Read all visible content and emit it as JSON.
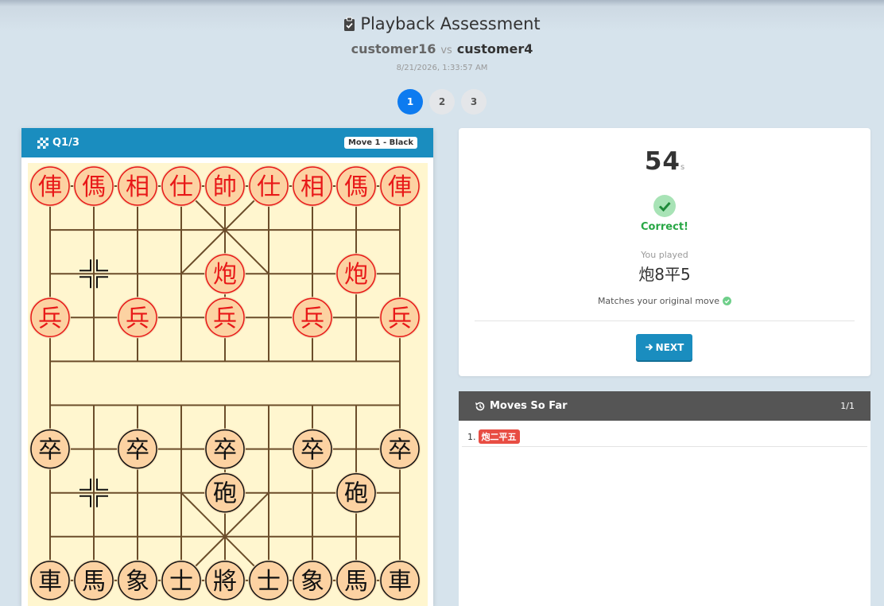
{
  "header": {
    "title": "Playback Assessment",
    "player1": "customer16",
    "vs": "vs",
    "player2": "customer4",
    "timestamp": "8/21/2026, 1:33:57 AM"
  },
  "pager": {
    "pages": [
      "1",
      "2",
      "3"
    ],
    "active": "1"
  },
  "board": {
    "question_label": "Q1/3",
    "move_badge": "Move 1 - Black",
    "colors": {
      "red": "#e81818",
      "black": "#111111",
      "line": "#6b4d2a",
      "piece_fill": "#fcd2a2",
      "board": "#fff6cf"
    },
    "red_pieces": [
      {
        "ch": "俥",
        "file": 0,
        "rank": 0
      },
      {
        "ch": "傌",
        "file": 1,
        "rank": 0
      },
      {
        "ch": "相",
        "file": 2,
        "rank": 0
      },
      {
        "ch": "仕",
        "file": 3,
        "rank": 0
      },
      {
        "ch": "帥",
        "file": 4,
        "rank": 0
      },
      {
        "ch": "仕",
        "file": 5,
        "rank": 0
      },
      {
        "ch": "相",
        "file": 6,
        "rank": 0
      },
      {
        "ch": "傌",
        "file": 7,
        "rank": 0
      },
      {
        "ch": "俥",
        "file": 8,
        "rank": 0
      },
      {
        "ch": "炮",
        "file": 4,
        "rank": 2
      },
      {
        "ch": "炮",
        "file": 7,
        "rank": 2
      },
      {
        "ch": "兵",
        "file": 0,
        "rank": 3
      },
      {
        "ch": "兵",
        "file": 2,
        "rank": 3
      },
      {
        "ch": "兵",
        "file": 4,
        "rank": 3
      },
      {
        "ch": "兵",
        "file": 6,
        "rank": 3
      },
      {
        "ch": "兵",
        "file": 8,
        "rank": 3
      }
    ],
    "black_pieces": [
      {
        "ch": "卒",
        "file": 0,
        "rank": 6
      },
      {
        "ch": "卒",
        "file": 2,
        "rank": 6
      },
      {
        "ch": "卒",
        "file": 4,
        "rank": 6
      },
      {
        "ch": "卒",
        "file": 6,
        "rank": 6
      },
      {
        "ch": "卒",
        "file": 8,
        "rank": 6
      },
      {
        "ch": "砲",
        "file": 4,
        "rank": 7
      },
      {
        "ch": "砲",
        "file": 7,
        "rank": 7
      },
      {
        "ch": "車",
        "file": 0,
        "rank": 9
      },
      {
        "ch": "馬",
        "file": 1,
        "rank": 9
      },
      {
        "ch": "象",
        "file": 2,
        "rank": 9
      },
      {
        "ch": "士",
        "file": 3,
        "rank": 9
      },
      {
        "ch": "將",
        "file": 4,
        "rank": 9
      },
      {
        "ch": "士",
        "file": 5,
        "rank": 9
      },
      {
        "ch": "象",
        "file": 6,
        "rank": 9
      },
      {
        "ch": "馬",
        "file": 7,
        "rank": 9
      },
      {
        "ch": "車",
        "file": 8,
        "rank": 9
      }
    ],
    "markers": [
      {
        "file": 1,
        "rank": 2
      },
      {
        "file": 1,
        "rank": 7
      }
    ]
  },
  "result": {
    "timer_value": "54",
    "timer_unit": "s",
    "status": "Correct!",
    "played_label": "You played",
    "played_move": "炮8平5",
    "match_text": "Matches your original move",
    "next_label": "NEXT"
  },
  "moves": {
    "title": "Moves So Far",
    "count": "1/1",
    "items": [
      {
        "num": "1.",
        "move": "炮二平五"
      }
    ]
  }
}
